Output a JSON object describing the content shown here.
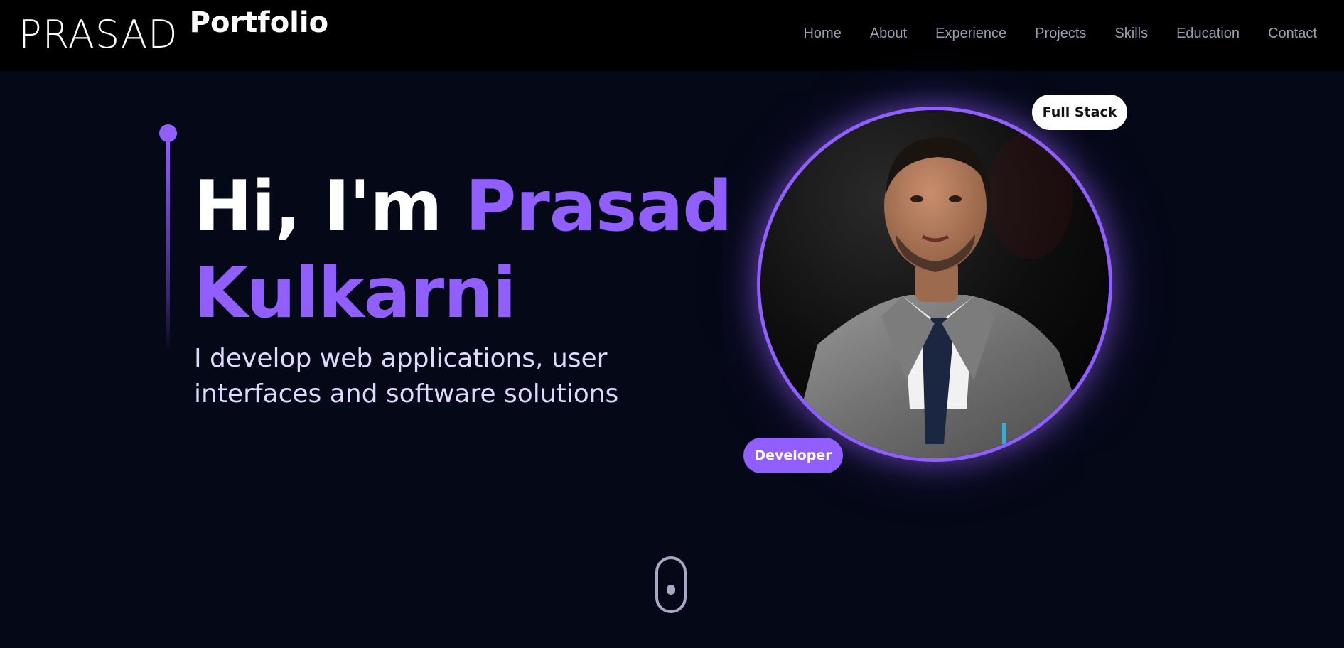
{
  "brand": {
    "name": "PRASAD",
    "suffix": "Portfolio"
  },
  "nav": {
    "links": [
      "Home",
      "About",
      "Experience",
      "Projects",
      "Skills",
      "Education",
      "Contact"
    ]
  },
  "hero": {
    "greeting": "Hi, I'm ",
    "name_first": "Prasad",
    "name_last": "Kulkarni",
    "subtitle_line1": "I develop web applications, user",
    "subtitle_line2": "interfaces and software solutions",
    "badge_top": "Full Stack",
    "badge_bottom": "Developer"
  },
  "colors": {
    "accent": "#915eff",
    "background": "#050816",
    "navbar": "#000000",
    "nav_text": "#9aa0b3"
  },
  "icons": {
    "scroll": "mouse-scroll-icon"
  }
}
